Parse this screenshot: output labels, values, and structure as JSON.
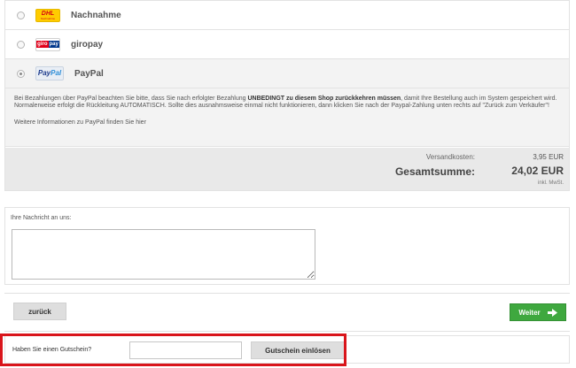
{
  "payment": {
    "methods": [
      {
        "label": "Nachnahme",
        "icon": "dhl-logo-icon",
        "logo_text": "DHL",
        "logo_subtext": "Nachnahme",
        "selected": false
      },
      {
        "label": "giropay",
        "icon": "giropay-logo-icon",
        "logo_text_1": "giro",
        "logo_text_2": "pay",
        "selected": false
      },
      {
        "label": "PayPal",
        "icon": "paypal-logo-icon",
        "logo_text_1": "Pay",
        "logo_text_2": "Pal",
        "selected": true
      }
    ],
    "info_before": "Bei Bezahlungen über PayPal beachten Sie bitte, dass Sie nach erfolgter Bezahlung ",
    "info_bold": "UNBEDINGT zu diesem Shop zurückkehren müssen",
    "info_after": ", damit Ihre Bestellung auch im System gespeichert wird. Normalerweise erfolgt die Rückleitung AUTOMATISCH. Sollte dies ausnahmsweise einmal nicht funktionieren, dann klicken Sie nach der Paypal-Zahlung unten rechts auf \"Zurück zum Verkäufer\"!",
    "info_link": "Weitere Informationen zu PayPal finden Sie hier"
  },
  "totals": {
    "shipping_label": "Versandkosten:",
    "shipping_value": "3,95 EUR",
    "sum_label": "Gesamtsumme:",
    "sum_value": "24,02 EUR",
    "vat_note": "inkl. MwSt."
  },
  "message": {
    "label": "Ihre Nachricht an uns:",
    "value": ""
  },
  "nav": {
    "back_label": "zurück",
    "next_label": "Weiter",
    "next_icon": "arrow-right-icon"
  },
  "voucher": {
    "label": "Haben Sie einen Gutschein?",
    "input_value": "",
    "button_label": "Gutschein einlösen"
  },
  "colors": {
    "accent_green": "#3fa83f",
    "highlight_red": "#d9151b"
  }
}
